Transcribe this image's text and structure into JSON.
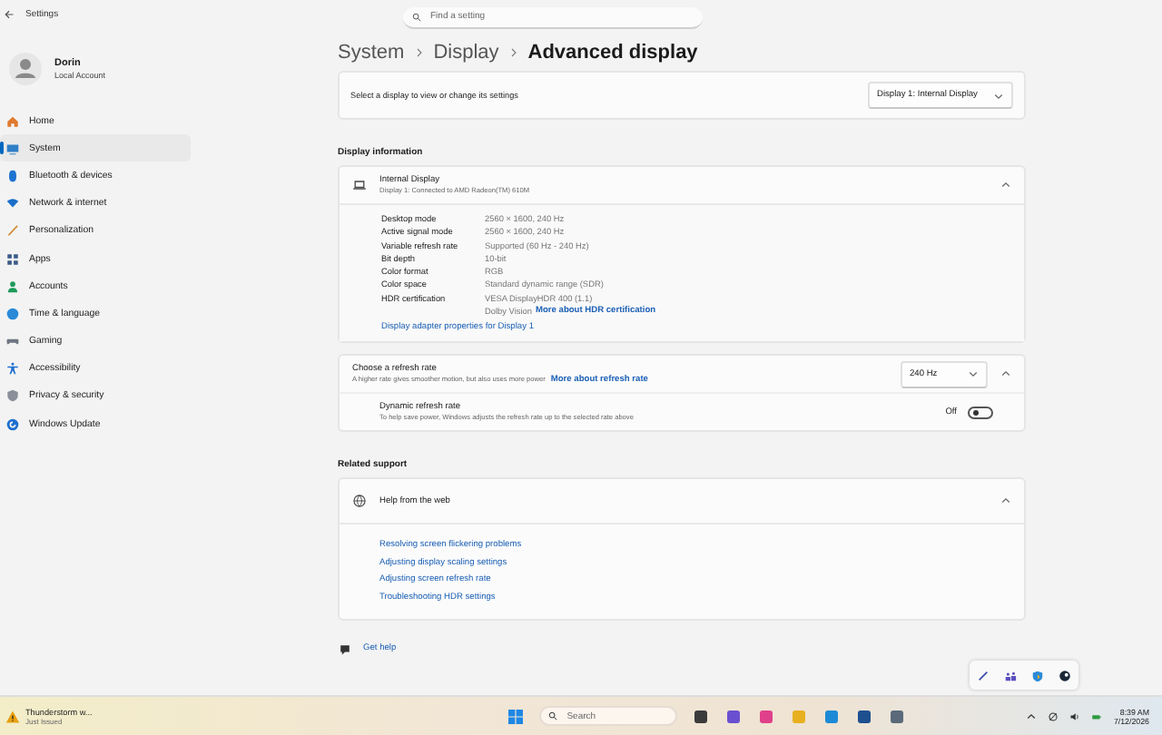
{
  "window": {
    "title": "Settings"
  },
  "user": {
    "name": "Dorin",
    "account": "Local Account"
  },
  "nav": [
    {
      "label": "Home",
      "selected": false
    },
    {
      "label": "System",
      "selected": true
    },
    {
      "label": "Bluetooth & devices",
      "selected": false
    },
    {
      "label": "Network & internet",
      "selected": false
    },
    {
      "label": "Personalization",
      "selected": false
    },
    {
      "label": "Apps",
      "selected": false
    },
    {
      "label": "Accounts",
      "selected": false
    },
    {
      "label": "Time & language",
      "selected": false
    },
    {
      "label": "Gaming",
      "selected": false
    },
    {
      "label": "Accessibility",
      "selected": false
    },
    {
      "label": "Privacy & security",
      "selected": false
    },
    {
      "label": "Windows Update",
      "selected": false
    }
  ],
  "search": {
    "placeholder": "Find a setting"
  },
  "breadcrumb": [
    "System",
    "Display",
    "Advanced display"
  ],
  "display_select": {
    "label": "Select a display to view or change its settings",
    "value": "Display 1: Internal Display"
  },
  "display_information": {
    "heading": "Display information",
    "title": "Internal Display",
    "subtitle": "Display 1: Connected to AMD Radeon(TM) 610M",
    "expanded": true,
    "rows": [
      {
        "label": "Desktop mode",
        "value": "2560 × 1600, 240 Hz"
      },
      {
        "label": "Active signal mode",
        "value": "2560 × 1600, 240 Hz"
      },
      {
        "label": "Variable refresh rate",
        "value": "Supported (60 Hz - 240 Hz)"
      },
      {
        "label": "Bit depth",
        "value": "10-bit"
      },
      {
        "label": "Color format",
        "value": "RGB"
      },
      {
        "label": "Color space",
        "value": "Standard dynamic range (SDR)"
      },
      {
        "label": "HDR certification",
        "value": "VESA DisplayHDR 400 (1.1)"
      }
    ],
    "hdr_extra": "Dolby Vision",
    "hdr_link": "More about HDR certification",
    "adapter_link": "Display adapter properties for Display 1"
  },
  "refresh": {
    "title": "Choose a refresh rate",
    "description": "A higher rate gives smoother motion, but also uses more power",
    "link": "More about refresh rate",
    "value": "240 Hz",
    "expanded": true,
    "dynamic": {
      "title": "Dynamic refresh rate",
      "description": "To help save power, Windows adjusts the refresh rate up to the selected rate above",
      "state_label": "Off",
      "on": false
    }
  },
  "related": {
    "heading": "Related support",
    "title": "Help from the web",
    "expanded": true,
    "links": [
      "Resolving screen flickering problems",
      "Adjusting display scaling settings",
      "Adjusting screen refresh rate",
      "Troubleshooting HDR settings"
    ]
  },
  "get_help": "Get help",
  "taskbar": {
    "weather_title": "Thunderstorm w...",
    "weather_subtitle": "Just Issued",
    "search_placeholder": "Search",
    "time": "8:39 AM",
    "date": "7/12/2026"
  }
}
